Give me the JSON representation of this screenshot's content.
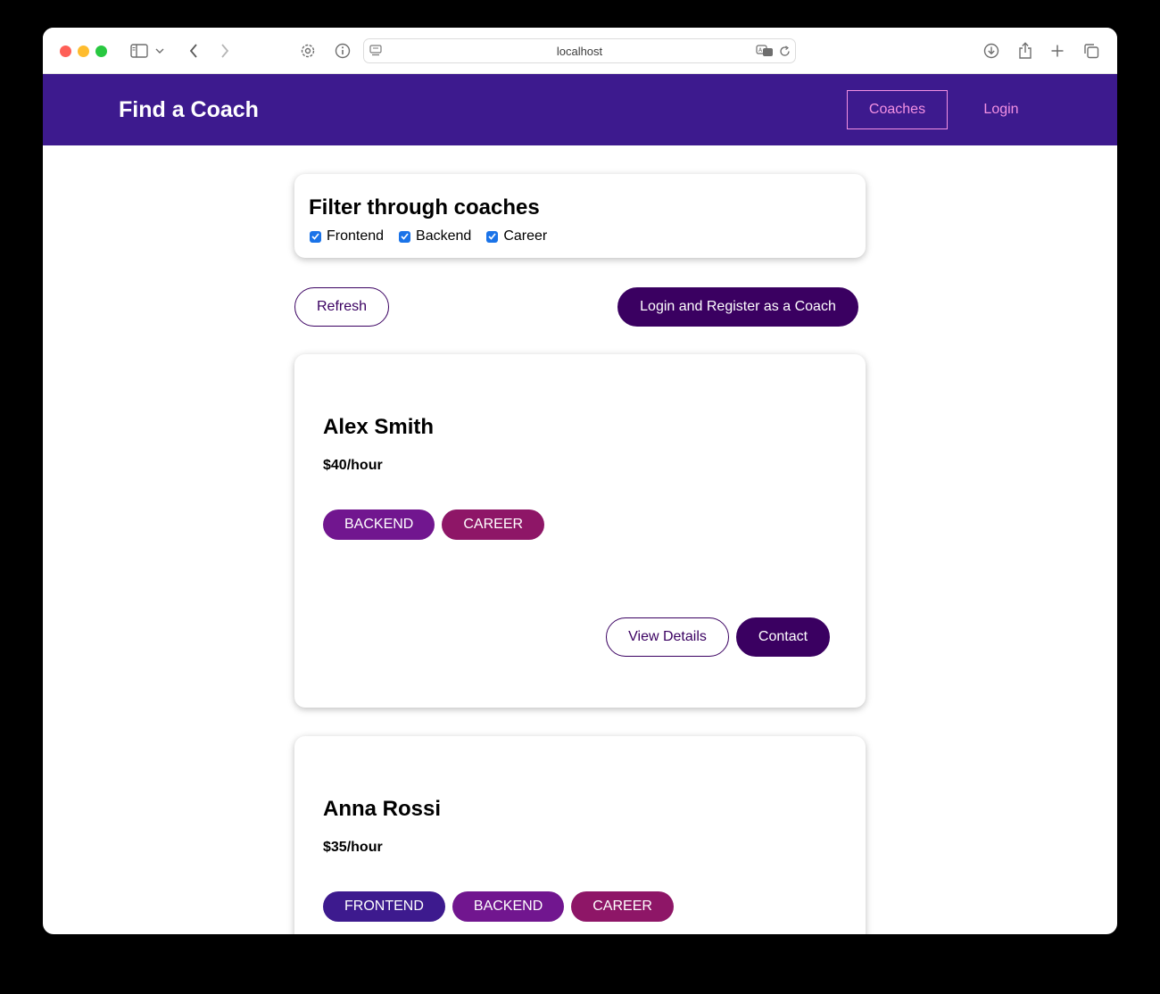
{
  "browser": {
    "url": "localhost"
  },
  "header": {
    "brand": "Find a Coach",
    "nav": [
      {
        "label": "Coaches"
      },
      {
        "label": "Login"
      }
    ]
  },
  "filter": {
    "title": "Filter through coaches",
    "options": [
      {
        "label": "Frontend",
        "checked": true
      },
      {
        "label": "Backend",
        "checked": true
      },
      {
        "label": "Career",
        "checked": true
      }
    ]
  },
  "controls": {
    "refresh_label": "Refresh",
    "register_label": "Login and Register as a Coach"
  },
  "coaches": [
    {
      "name": "Alex Smith",
      "rate": "$40/hour",
      "areas": [
        "BACKEND",
        "CAREER"
      ],
      "details_label": "View Details",
      "contact_label": "Contact"
    },
    {
      "name": "Anna Rossi",
      "rate": "$35/hour",
      "areas": [
        "FRONTEND",
        "BACKEND",
        "CAREER"
      ]
    }
  ],
  "colors": {
    "header_bg": "#3d1a8e",
    "nav_link": "#f391e3",
    "primary": "#3a0061",
    "frontend_badge": "#3d1a8e",
    "backend_badge": "#71168f",
    "career_badge": "#8e1667"
  }
}
